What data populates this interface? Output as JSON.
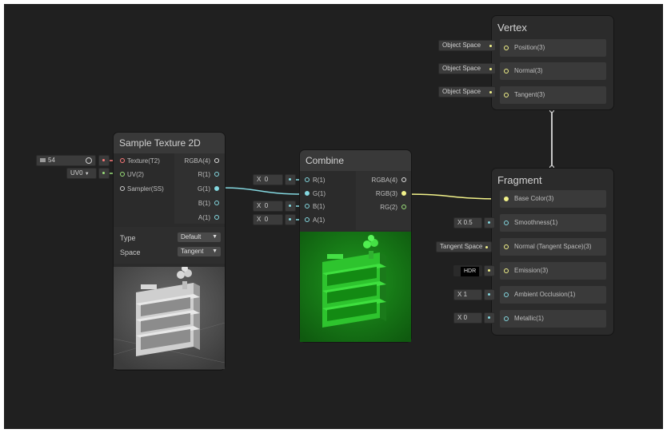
{
  "graph": {
    "wire_colors": {
      "texture": "#ff7a7a",
      "uv": "#9be07a",
      "float": "#84d8e0",
      "vector3": "#f2f28a",
      "vector3_link": "#c8c8a0"
    }
  },
  "nodes": {
    "sample_texture": {
      "title": "Sample Texture 2D",
      "inputs": [
        "Texture(T2)",
        "UV(2)",
        "Sampler(SS)"
      ],
      "outputs": [
        "RGBA(4)",
        "R(1)",
        "G(1)",
        "B(1)",
        "A(1)"
      ],
      "props": {
        "type_label": "Type",
        "type_value": "Default",
        "space_label": "Space",
        "space_value": "Tangent"
      }
    },
    "combine": {
      "title": "Combine",
      "inputs": [
        "R(1)",
        "G(1)",
        "B(1)",
        "A(1)"
      ],
      "outputs": [
        "RGBA(4)",
        "RGB(3)",
        "RG(2)"
      ],
      "input_defaults": {
        "r": {
          "axis": "X",
          "value": "0"
        },
        "b": {
          "axis": "X",
          "value": "0"
        },
        "a": {
          "axis": "X",
          "value": "0"
        }
      }
    },
    "vertex": {
      "title": "Vertex",
      "blocks": [
        "Position(3)",
        "Normal(3)",
        "Tangent(3)"
      ],
      "chips": [
        "Object Space",
        "Object Space",
        "Object Space"
      ]
    },
    "fragment": {
      "title": "Fragment",
      "blocks": [
        "Base Color(3)",
        "Smoothness(1)",
        "Normal (Tangent Space)(3)",
        "Emission(3)",
        "Ambient Occlusion(1)",
        "Metallic(1)"
      ],
      "smoothness": {
        "axis": "X",
        "value": "0.5"
      },
      "normal_space": "Tangent Space",
      "emission_mode": "HDR",
      "ao": {
        "axis": "X",
        "value": "1"
      },
      "metallic": {
        "axis": "X",
        "value": "0"
      }
    }
  },
  "external_inputs": {
    "texture_asset": {
      "icon": "texture-icon",
      "label": "54"
    },
    "uv_channel": {
      "value": "UV0",
      "caret": "▼"
    }
  },
  "icons": {
    "dropdown_caret": "▼",
    "object_picker": "target-icon"
  }
}
